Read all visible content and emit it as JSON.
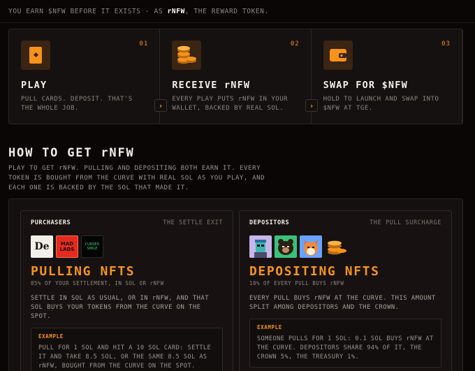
{
  "intro": {
    "before": "YOU EARN $NFW BEFORE IT EXISTS - AS ",
    "highlight": "rNFW",
    "after": ", THE REWARD TOKEN."
  },
  "steps": [
    {
      "number": "01",
      "title": "PLAY",
      "description": "PULL CARDS. DEPOSIT. THAT'S THE WHOLE JOB.",
      "icon": "card-icon"
    },
    {
      "number": "02",
      "title": "RECEIVE rNFW",
      "description": "EVERY PLAY PUTS rNFW IN YOUR WALLET, BACKED BY REAL SOL.",
      "icon": "coins-icon"
    },
    {
      "number": "03",
      "title": "SWAP FOR $NFW",
      "description": "HOLD TO LAUNCH AND SWAP INTO $NFW AT TGE.",
      "icon": "wallet-icon"
    }
  ],
  "step_arrow": "›",
  "how": {
    "title": "HOW TO GET rNFW",
    "description": "PLAY TO GET rNFW. PULLING AND DEPOSITING BOTH EARN IT. EVERY TOKEN IS BOUGHT FROM THE CURVE WITH REAL SOL AS YOU PLAY, AND EACH ONE IS BACKED BY THE SOL THAT MADE IT."
  },
  "cards": [
    {
      "label": "PURCHASERS",
      "tag": "THE SETTLE EXIT",
      "thumbs": [
        {
          "name": "degods-thumb",
          "text": "De"
        },
        {
          "name": "mad-lads-thumb",
          "text": "MAD LADS"
        },
        {
          "name": "cursed-thumb",
          "text": "CURSED SMILE"
        }
      ],
      "title": "PULLING NFTS",
      "subtitle": "85% OF YOUR SETTLEMENT, IN SOL OR rNFW",
      "description": "SETTLE IN SOL AS USUAL, OR IN rNFW, AND THAT SOL BUYS YOUR TOKENS FROM THE CURVE ON THE SPOT.",
      "example_label": "EXAMPLE",
      "example_text": "PULL FOR 1 SOL AND HIT A 10 SOL CARD: SETTLE IT AND TAKE 8.5 SOL, OR THE SAME 8.5 SOL AS rNFW, BOUGHT FROM THE CURVE ON THE SPOT."
    },
    {
      "label": "DEPOSITORS",
      "tag": "THE PULL SURCHARGE",
      "thumbs": [
        {
          "name": "robot-avatar-thumb",
          "text": ""
        },
        {
          "name": "bear-avatar-thumb",
          "text": ""
        },
        {
          "name": "fox-avatar-thumb",
          "text": ""
        },
        {
          "name": "coins-thumb",
          "text": ""
        }
      ],
      "title": "DEPOSITING NFTS",
      "subtitle": "10% OF EVERY PULL BUYS rNFW",
      "description": "EVERY PULL BUYS rNFW AT THE CURVE. THIS AMOUNT SPLIT AMONG DEPOSITORS AND THE CROWN.",
      "example_label": "EXAMPLE",
      "example_text": "SOMEONE PULLS FOR 1 SOL: 0.1 SOL BUYS rNFW AT THE CURVE. DEPOSITORS SHARE 94% OF IT, THE CROWN 5%, THE TREASURY 1%."
    }
  ],
  "colors": {
    "accent": "#f7931a",
    "background": "#0a0605",
    "panel": "#151110"
  }
}
